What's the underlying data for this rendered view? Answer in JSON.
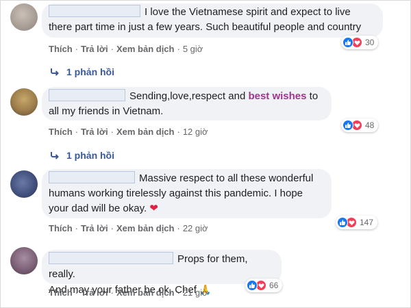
{
  "colors": {
    "bubble_bg": "#f0f2f5",
    "link": "#385898",
    "highlight": "#a0348e",
    "like_blue": "#1877f2",
    "love_red": "#f33e58"
  },
  "comments": [
    {
      "text": "I love the Vietnamese spirit and expect to live there part time in just a few years. Such beautiful people and country",
      "actions": {
        "like": "Thích",
        "reply": "Trả lời",
        "translate": "Xem bản dịch",
        "time": "5 giờ"
      },
      "reaction_count": "30",
      "replies": "1 phản hồi"
    },
    {
      "text_before": "Sending,love,respect and ",
      "text_highlight": "best wishes",
      "text_after": " to all my friends in Vietnam.",
      "actions": {
        "like": "Thích",
        "reply": "Trả lời",
        "translate": "Xem bản dịch",
        "time": "12 giờ"
      },
      "reaction_count": "48",
      "replies": "1 phản hồi"
    },
    {
      "text": "Massive respect to all these wonderful humans working tirelessly against this pandemic. I hope your dad will be okay.",
      "emoji": "❤",
      "actions": {
        "like": "Thích",
        "reply": "Trả lời",
        "translate": "Xem bản dịch",
        "time": "22 giờ"
      },
      "reaction_count": "147"
    },
    {
      "text_line1": "Props for them, really.",
      "text_line2": "And may your father be ok, Chef",
      "emoji": "🙏",
      "actions": {
        "like": "Thích",
        "reply": "Trả lời",
        "translate": "Xem bản dịch",
        "time": "21 giờ"
      },
      "reaction_count": "66"
    }
  ]
}
